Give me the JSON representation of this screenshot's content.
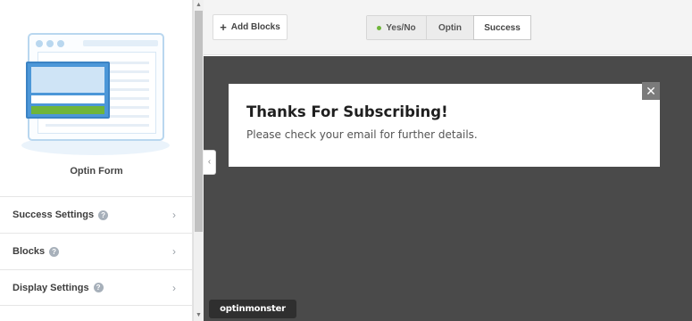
{
  "sidebar": {
    "preview_label": "Optin Form",
    "items": [
      {
        "label": "Success Settings",
        "has_help": true
      },
      {
        "label": "Blocks",
        "has_help": true
      },
      {
        "label": "Display Settings",
        "has_help": true
      }
    ],
    "help_glyph": "?",
    "chevron_glyph": "›"
  },
  "toolbar": {
    "add_blocks_label": "Add Blocks",
    "add_blocks_icon": "plus-icon",
    "tabs": [
      {
        "label": "Yes/No",
        "status_dot_color": "#6fb53a",
        "active": false
      },
      {
        "label": "Optin",
        "active": false
      },
      {
        "label": "Success",
        "active": true
      }
    ]
  },
  "canvas": {
    "background": "#4a4a4a",
    "collapse_glyph": "‹",
    "popup": {
      "title": "Thanks For Subscribing!",
      "message": "Please check your email for further details.",
      "close_glyph": "✕"
    },
    "brand": "optinmonster"
  },
  "colors": {
    "accent_green": "#6fb53a",
    "accent_blue": "#4c97d8"
  }
}
